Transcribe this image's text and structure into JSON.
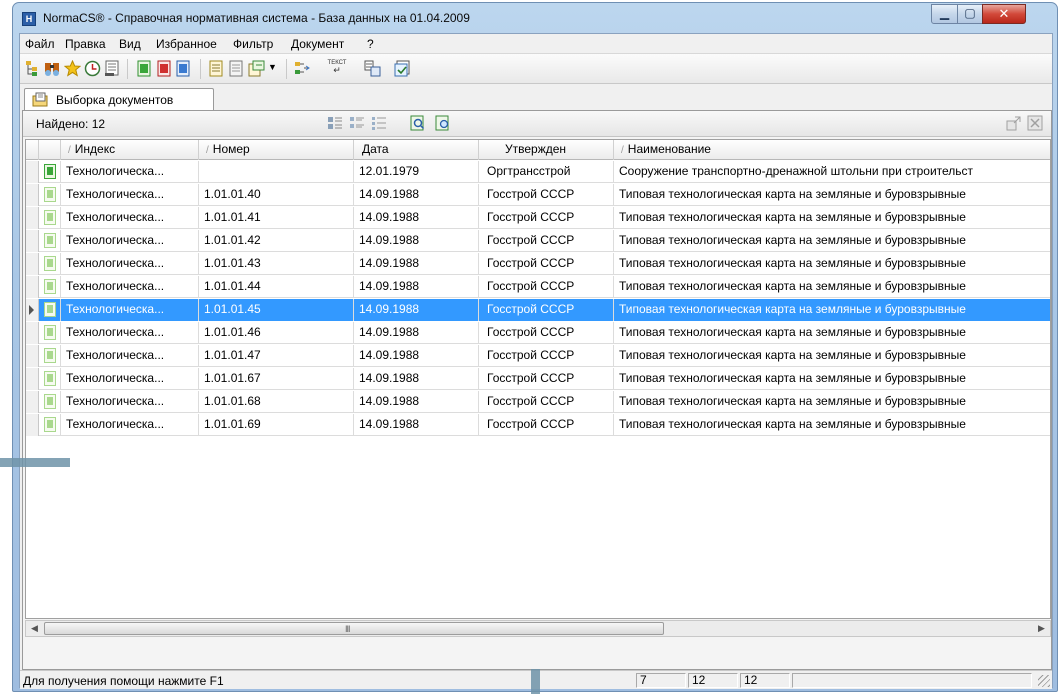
{
  "window": {
    "title": "NormaCS® - Справочная нормативная система - База данных на 01.04.2009",
    "app_icon": "Н"
  },
  "menu": [
    "Файл",
    "Правка",
    "Вид",
    "Избранное",
    "Фильтр",
    "Документ",
    "?"
  ],
  "toolbar": {
    "icons": [
      "tree-view-icon",
      "find-icon",
      "favorites-star-icon",
      "history-icon",
      "card-view-icon",
      "doc-green-icon",
      "doc-red-icon",
      "doc-blue-icon",
      "doc-yellow-icon",
      "doc-gray-icon",
      "doc-export-icon",
      "dropdown-arrow-icon",
      "link-icon",
      "text-icon",
      "compare-icon",
      "check-doc-icon"
    ],
    "text_button_label": "ТЕКСТ"
  },
  "tab": {
    "label": "Выборка документов"
  },
  "panel": {
    "found_label": "Найдено: 12"
  },
  "grid": {
    "columns": [
      "Индекс",
      "Номер",
      "Дата",
      "Утвержден",
      "Наименование"
    ],
    "sorted_marks": [
      "/",
      "/",
      "",
      "",
      "/"
    ],
    "rows": [
      {
        "index": "Технологическа...",
        "number": "",
        "date": "12.01.1979",
        "approved": "Оргтрансстрой",
        "name": "Сооружение транспортно-дренажной штольни при строительст",
        "icon": "green",
        "selected": false
      },
      {
        "index": "Технологическа...",
        "number": "1.01.01.40",
        "date": "14.09.1988",
        "approved": "Госстрой СССР",
        "name": "Типовая технологическая карта на земляные и буровзрывные",
        "icon": "light",
        "selected": false
      },
      {
        "index": "Технологическа...",
        "number": "1.01.01.41",
        "date": "14.09.1988",
        "approved": "Госстрой СССР",
        "name": "Типовая технологическая карта на земляные и буровзрывные",
        "icon": "light",
        "selected": false
      },
      {
        "index": "Технологическа...",
        "number": "1.01.01.42",
        "date": "14.09.1988",
        "approved": "Госстрой СССР",
        "name": "Типовая технологическая карта на земляные и буровзрывные",
        "icon": "light",
        "selected": false
      },
      {
        "index": "Технологическа...",
        "number": "1.01.01.43",
        "date": "14.09.1988",
        "approved": "Госстрой СССР",
        "name": "Типовая технологическая карта на земляные и буровзрывные",
        "icon": "light",
        "selected": false
      },
      {
        "index": "Технологическа...",
        "number": "1.01.01.44",
        "date": "14.09.1988",
        "approved": "Госстрой СССР",
        "name": "Типовая технологическая карта на земляные и буровзрывные",
        "icon": "light",
        "selected": false
      },
      {
        "index": "Технологическа...",
        "number": "1.01.01.45",
        "date": "14.09.1988",
        "approved": "Госстрой СССР",
        "name": "Типовая технологическая карта на земляные и буровзрывные",
        "icon": "light",
        "selected": true
      },
      {
        "index": "Технологическа...",
        "number": "1.01.01.46",
        "date": "14.09.1988",
        "approved": "Госстрой СССР",
        "name": "Типовая технологическая карта на земляные и буровзрывные",
        "icon": "light",
        "selected": false
      },
      {
        "index": "Технологическа...",
        "number": "1.01.01.47",
        "date": "14.09.1988",
        "approved": "Госстрой СССР",
        "name": "Типовая технологическая карта на земляные и буровзрывные",
        "icon": "light",
        "selected": false
      },
      {
        "index": "Технологическа...",
        "number": "1.01.01.67",
        "date": "14.09.1988",
        "approved": "Госстрой СССР",
        "name": "Типовая технологическая карта на земляные и буровзрывные",
        "icon": "light",
        "selected": false
      },
      {
        "index": "Технологическа...",
        "number": "1.01.01.68",
        "date": "14.09.1988",
        "approved": "Госстрой СССР",
        "name": "Типовая технологическая карта на земляные и буровзрывные",
        "icon": "light",
        "selected": false
      },
      {
        "index": "Технологическа...",
        "number": "1.01.01.69",
        "date": "14.09.1988",
        "approved": "Госстрой СССР",
        "name": "Типовая технологическая карта на земляные и буровзрывные",
        "icon": "light",
        "selected": false
      }
    ]
  },
  "scrollbar": {
    "grip": "III"
  },
  "status": {
    "help_text": "Для получения помощи нажмите F1",
    "cells": [
      "7",
      "12",
      "12",
      ""
    ]
  },
  "colors": {
    "selection": "#3399ff",
    "doc_green": "#3aa63a",
    "doc_light": "#a9d88d"
  }
}
